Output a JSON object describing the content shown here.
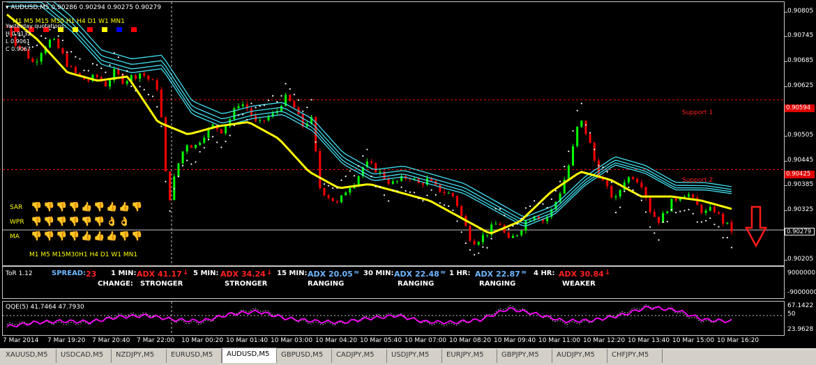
{
  "header": {
    "title": "AUDUSD,M5",
    "ohlc": "0.90286 0.90294 0.90275 0.90279"
  },
  "timeframes": [
    "M1",
    "M5",
    "M15",
    "M30",
    "H1",
    "H4",
    "D1",
    "W1",
    "MN1"
  ],
  "timeframe_colors": [
    "#ff0000",
    "#ff0000",
    "#ff0000",
    "#ffff00",
    "#ffff00",
    "#ff0000",
    "#ffff00",
    "#0000ff",
    "#ff0000"
  ],
  "yesterday": {
    "title": "Yesterday quotations:",
    "h": "H 0.9132",
    "l": "L 0.9061",
    "c": "C 0.9067"
  },
  "price_axis": {
    "labels": [
      "0.90805",
      "0.90745",
      "0.90685",
      "0.90625",
      "0.90565",
      "0.90505",
      "0.90445",
      "0.90385",
      "0.90325",
      "0.90265",
      "0.90205"
    ],
    "support1_price": "0.90594",
    "support2_price": "0.90425",
    "current_price": "0.90279"
  },
  "levels": {
    "support1": "Support 1",
    "support2": "Support 2"
  },
  "signals": {
    "rows": [
      {
        "label": "SAR",
        "icons": [
          "down",
          "down",
          "down",
          "down",
          "up",
          "down",
          "up",
          "up",
          "down"
        ]
      },
      {
        "label": "WPR",
        "icons": [
          "down",
          "down",
          "down",
          "down",
          "down",
          "down",
          "ok",
          "ok",
          "none"
        ]
      },
      {
        "label": "MA",
        "icons": [
          "down",
          "down",
          "down",
          "down",
          "up",
          "up",
          "up",
          "down",
          "down"
        ]
      }
    ],
    "bottom_labels": "M1  M5  M15M30H1  H4  D1  W1 MN1"
  },
  "tor": {
    "name": "ToR 1.12",
    "spread_label": "SPREAD:",
    "spread_value": "23",
    "change_label": "CHANGE:",
    "frames": [
      {
        "label": "1 MIN:",
        "adx": "ADX 41.17",
        "dir": "down",
        "change": "STRONGER",
        "color": "#ff2020"
      },
      {
        "label": "5 MIN:",
        "adx": "ADX 34.24",
        "dir": "down",
        "change": "STRONGER",
        "color": "#ff2020"
      },
      {
        "label": "15 MIN:",
        "adx": "ADX 20.05",
        "dir": "range",
        "change": "RANGING",
        "color": "#6fb7ff"
      },
      {
        "label": "30 MIN:",
        "adx": "ADX 22.48",
        "dir": "range",
        "change": "RANGING",
        "color": "#6fb7ff"
      },
      {
        "label": "1 HR:",
        "adx": "ADX 22.87",
        "dir": "range",
        "change": "RANGING",
        "color": "#6fb7ff"
      },
      {
        "label": "4 HR:",
        "adx": "ADX 30.84",
        "dir": "down",
        "change": "WEAKER",
        "color": "#ff2020"
      }
    ],
    "axis_top": "9000000",
    "axis_bottom": "-9000000"
  },
  "qqe": {
    "label": "QQE(5) 41.7464 47.7930",
    "axis": [
      "67.1422",
      "50",
      "23.9628"
    ]
  },
  "time_axis": [
    "7 Mar 2014",
    "7 Mar 19:20",
    "7 Mar 20:40",
    "7 Mar 22:00",
    "10 Mar 00:20",
    "10 Mar 01:40",
    "10 Mar 03:00",
    "10 Mar 04:20",
    "10 Mar 05:40",
    "10 Mar 07:00",
    "10 Mar 08:20",
    "10 Mar 09:40",
    "10 Mar 11:00",
    "10 Mar 12:20",
    "10 Mar 13:40",
    "10 Mar 15:00",
    "10 Mar 16:20"
  ],
  "tabs": [
    "XAUUSD,M5",
    "USDCAD,M5",
    "NZDJPY,M5",
    "EURUSD,M5",
    "AUDUSD,M5",
    "GBPUSD,M5",
    "CADJPY,M5",
    "USDJPY,M5",
    "EURJPY,M5",
    "GBPJPY,M5",
    "AUDJPY,M5",
    "CHFJPY,M5"
  ],
  "active_tab": "AUDUSD,M5",
  "colors": {
    "bull": "#00ff00",
    "bear": "#ff0000",
    "ema": "#ffff00",
    "bands": "#40e0f0",
    "psar": "#ffffff",
    "qqe": "#ff00ff",
    "support": "#ff0000"
  },
  "icons": {
    "down": "thumbs-down-icon",
    "up": "thumbs-up-icon",
    "ok": "hand-ok-icon",
    "arrow": "sell-arrow-icon"
  },
  "chart_data": {
    "type": "candlestick",
    "symbol": "AUDUSD",
    "timeframe": "M5",
    "ylim": [
      0.9019,
      0.9083
    ],
    "close": [
      0.9077,
      0.9073,
      0.9071,
      0.9068,
      0.9072,
      0.9074,
      0.9071,
      0.9067,
      0.9065,
      0.9064,
      0.9065,
      0.9063,
      0.9066,
      0.9064,
      0.9065,
      0.9066,
      0.9064,
      0.9062,
      0.9034,
      0.9043,
      0.9049,
      0.9048,
      0.9051,
      0.9053,
      0.9052,
      0.9055,
      0.9059,
      0.9057,
      0.9053,
      0.9055,
      0.9056,
      0.906,
      0.9058,
      0.9053,
      0.9055,
      0.9038,
      0.9036,
      0.9034,
      0.9038,
      0.904,
      0.9044,
      0.9043,
      0.9041,
      0.9039,
      0.904,
      0.9041,
      0.9039,
      0.904,
      0.9038,
      0.9037,
      0.9036,
      0.903,
      0.9025,
      0.9026,
      0.9028,
      0.903,
      0.9025,
      0.9027,
      0.903,
      0.9032,
      0.903,
      0.9033,
      0.9038,
      0.9045,
      0.9055,
      0.905,
      0.9042,
      0.9038,
      0.9035,
      0.904,
      0.9041,
      0.9039,
      0.9032,
      0.903,
      0.9034,
      0.9036,
      0.9037,
      0.9034,
      0.9032,
      0.9033,
      0.903,
      0.90279
    ],
    "ema_levels": [
      0.908,
      0.9074,
      0.9066,
      0.9064,
      0.9065,
      0.9054,
      0.9051,
      0.9053,
      0.9054,
      0.905,
      0.9042,
      0.9038,
      0.9039,
      0.9037,
      0.9035,
      0.9031,
      0.9027,
      0.903,
      0.9037,
      0.9042,
      0.904,
      0.9036,
      0.9036,
      0.9035,
      0.9033
    ],
    "qqe_values": [
      34,
      40,
      42,
      41,
      48,
      50,
      44,
      42,
      52,
      56,
      46,
      42,
      40,
      46,
      50,
      41,
      40,
      44,
      60,
      52,
      42,
      43,
      50,
      62,
      58,
      44,
      41.7
    ]
  }
}
